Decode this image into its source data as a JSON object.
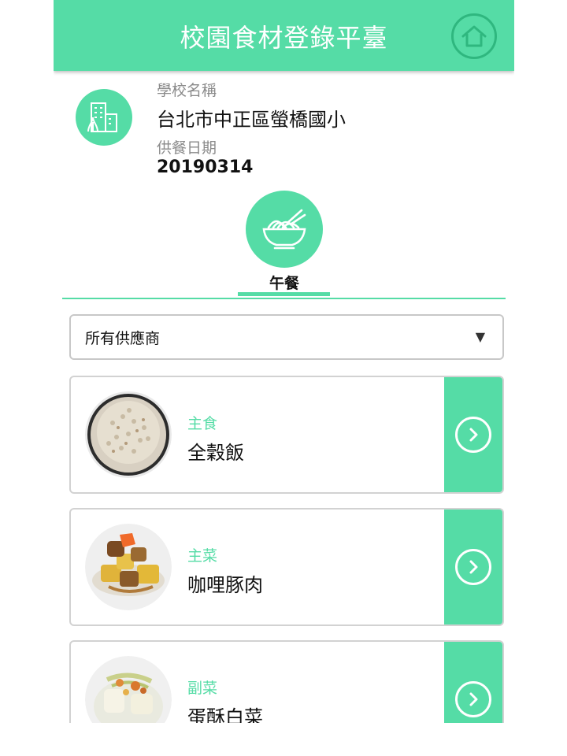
{
  "header": {
    "title": "校園食材登錄平臺",
    "home_icon": "home-icon",
    "color": "#55dca6"
  },
  "school": {
    "name_label": "學校名稱",
    "name": "台北市中正區螢橋國小",
    "date_label": "供餐日期",
    "date": "20190314",
    "icon": "building-icon"
  },
  "meal_tabs": [
    {
      "label": "午餐",
      "icon": "noodle-bowl-icon",
      "selected": true
    }
  ],
  "supplier_filter": {
    "value": "所有供應商",
    "arrow": "▼"
  },
  "dishes": [
    {
      "category": "主食",
      "name": "全穀飯",
      "image": "rice-bowl-photo"
    },
    {
      "category": "主菜",
      "name": "咖哩豚肉",
      "image": "curry-pork-photo"
    },
    {
      "category": "副菜",
      "name": "蛋酥白菜",
      "image": "cabbage-egg-photo"
    }
  ],
  "colors": {
    "accent": "#55dca6",
    "category_text": "#55dca6",
    "border": "#d2d2d2"
  }
}
